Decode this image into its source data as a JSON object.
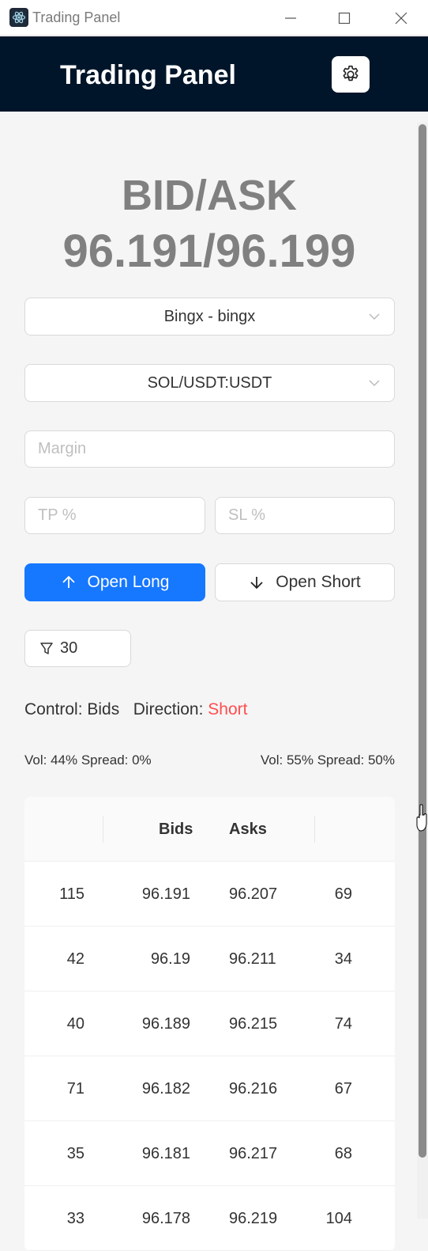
{
  "window": {
    "title": "Trading Panel",
    "app_icon": "electron-icon"
  },
  "header": {
    "title": "Trading Panel",
    "settings_icon": "gear-icon"
  },
  "quote": {
    "label": "BID/ASK",
    "value": "96.191/96.199"
  },
  "exchange_select": {
    "value": "Bingx - bingx"
  },
  "symbol_select": {
    "value": "SOL/USDT:USDT"
  },
  "margin_input": {
    "placeholder": "Margin",
    "value": ""
  },
  "tp_input": {
    "placeholder": "TP %",
    "value": ""
  },
  "sl_input": {
    "placeholder": "SL %",
    "value": ""
  },
  "buttons": {
    "open_long": "Open Long",
    "open_short": "Open Short"
  },
  "filter": {
    "icon": "filter-icon",
    "value": "30"
  },
  "control": {
    "control_label": "Control:",
    "control_value": "Bids",
    "direction_label": "Direction:",
    "direction_value": "Short"
  },
  "stats": {
    "left": "Vol: 44% Spread: 0%",
    "right": "Vol: 55% Spread: 50%"
  },
  "orderbook": {
    "headers": {
      "bids": "Bids",
      "asks": "Asks"
    },
    "rows": [
      {
        "bid_size": "115",
        "bid": "96.191",
        "ask": "96.207",
        "ask_size": "69"
      },
      {
        "bid_size": "42",
        "bid": "96.19",
        "ask": "96.211",
        "ask_size": "34"
      },
      {
        "bid_size": "40",
        "bid": "96.189",
        "ask": "96.215",
        "ask_size": "74"
      },
      {
        "bid_size": "71",
        "bid": "96.182",
        "ask": "96.216",
        "ask_size": "67"
      },
      {
        "bid_size": "35",
        "bid": "96.181",
        "ask": "96.217",
        "ask_size": "68"
      },
      {
        "bid_size": "33",
        "bid": "96.178",
        "ask": "96.219",
        "ask_size": "104"
      }
    ]
  },
  "colors": {
    "header_bg": "#001529",
    "primary": "#1677ff",
    "short": "#ff4d4f"
  }
}
